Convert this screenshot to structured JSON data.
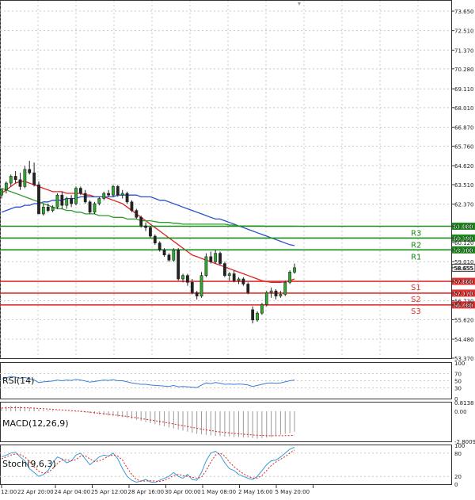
{
  "chart_data": {
    "type": "candlestick",
    "price_axis": {
      "ticks": [
        "73.650",
        "72.510",
        "71.370",
        "70.280",
        "69.110",
        "68.010",
        "66.870",
        "65.760",
        "64.620",
        "63.510",
        "62.370",
        "61.080",
        "60.390",
        "60.120",
        "59.700",
        "59.010",
        "58.655",
        "57.860",
        "57.170",
        "56.730",
        "56.480",
        "55.620",
        "54.480",
        "53.370"
      ],
      "ylim": [
        53.37,
        74.3
      ]
    },
    "time_axis": {
      "labels": [
        "12:00",
        "22 Apr 20:00",
        "24 Apr 04:00",
        "25 Apr 12:00",
        "28 Apr 16:00",
        "30 Apr 00:00",
        "1 May 08:00",
        "2 May 16:00",
        "5 May 20:00"
      ]
    },
    "current_price": "58.655",
    "levels": [
      {
        "name": "R3",
        "price": 61.08,
        "label": "61.080",
        "color": "#1a8a1a"
      },
      {
        "name": "R2",
        "price": 60.39,
        "label": "60.390",
        "color": "#1a8a1a"
      },
      {
        "name": "R1",
        "price": 59.7,
        "label": "59.700",
        "color": "#1a8a1a"
      },
      {
        "name": "S1",
        "price": 57.86,
        "label": "57.860",
        "color": "#e03030"
      },
      {
        "name": "S2",
        "price": 57.17,
        "label": "57.170",
        "color": "#e03030"
      },
      {
        "name": "S3",
        "price": 56.48,
        "label": "56.480",
        "color": "#e03030"
      }
    ],
    "candles": [
      [
        62.9,
        63.3,
        62.7,
        63.2
      ],
      [
        63.2,
        63.7,
        63.0,
        63.6
      ],
      [
        63.6,
        64.1,
        63.4,
        64.0
      ],
      [
        64.0,
        64.3,
        63.6,
        63.8
      ],
      [
        63.8,
        64.2,
        63.2,
        63.4
      ],
      [
        63.4,
        64.6,
        63.3,
        64.4
      ],
      [
        64.4,
        64.9,
        64.1,
        64.2
      ],
      [
        64.2,
        64.8,
        63.4,
        63.5
      ],
      [
        63.5,
        63.7,
        61.8,
        61.8
      ],
      [
        61.8,
        62.4,
        61.7,
        62.2
      ],
      [
        62.2,
        62.4,
        61.9,
        62.0
      ],
      [
        62.0,
        62.3,
        61.9,
        62.2
      ],
      [
        62.2,
        63.0,
        62.1,
        62.9
      ],
      [
        62.9,
        63.1,
        62.1,
        62.3
      ],
      [
        62.3,
        62.8,
        62.1,
        62.7
      ],
      [
        62.7,
        62.9,
        62.2,
        62.4
      ],
      [
        62.4,
        63.4,
        62.3,
        63.3
      ],
      [
        63.3,
        63.4,
        62.9,
        63.0
      ],
      [
        63.0,
        63.2,
        62.4,
        62.5
      ],
      [
        62.5,
        62.6,
        61.8,
        61.9
      ],
      [
        61.9,
        62.5,
        61.8,
        62.4
      ],
      [
        62.4,
        62.8,
        62.3,
        62.7
      ],
      [
        62.7,
        63.1,
        62.6,
        63.0
      ],
      [
        63.0,
        63.2,
        62.8,
        62.9
      ],
      [
        62.9,
        63.5,
        62.8,
        63.4
      ],
      [
        63.4,
        63.5,
        62.8,
        62.9
      ],
      [
        62.9,
        63.2,
        62.7,
        63.0
      ],
      [
        63.0,
        63.1,
        62.4,
        62.5
      ],
      [
        62.5,
        62.6,
        61.9,
        62.0
      ],
      [
        62.0,
        62.1,
        61.5,
        61.6
      ],
      [
        61.6,
        61.7,
        61.0,
        61.1
      ],
      [
        61.1,
        61.3,
        60.8,
        61.0
      ],
      [
        61.0,
        61.1,
        60.4,
        60.5
      ],
      [
        60.5,
        60.6,
        60.0,
        60.1
      ],
      [
        60.1,
        60.2,
        59.6,
        59.7
      ],
      [
        59.7,
        59.8,
        59.3,
        59.4
      ],
      [
        59.4,
        59.5,
        59.0,
        59.1
      ],
      [
        59.1,
        59.8,
        59.0,
        59.7
      ],
      [
        59.7,
        59.8,
        57.9,
        58.0
      ],
      [
        58.0,
        58.3,
        57.8,
        58.2
      ],
      [
        58.2,
        58.3,
        57.6,
        57.8
      ],
      [
        57.8,
        58.0,
        57.1,
        57.2
      ],
      [
        57.2,
        57.3,
        56.8,
        57.0
      ],
      [
        57.0,
        58.4,
        56.9,
        58.2
      ],
      [
        58.2,
        59.5,
        58.1,
        59.3
      ],
      [
        59.3,
        59.6,
        58.9,
        59.0
      ],
      [
        59.0,
        59.7,
        58.9,
        59.5
      ],
      [
        59.5,
        59.6,
        58.8,
        58.9
      ],
      [
        58.9,
        59.0,
        58.1,
        58.2
      ],
      [
        58.2,
        58.4,
        57.9,
        58.3
      ],
      [
        58.3,
        58.5,
        57.8,
        57.9
      ],
      [
        57.9,
        58.1,
        57.7,
        58.0
      ],
      [
        58.0,
        58.1,
        57.6,
        57.7
      ],
      [
        57.7,
        57.8,
        57.1,
        57.2
      ],
      [
        56.2,
        56.4,
        55.4,
        55.6
      ],
      [
        55.6,
        56.1,
        55.5,
        56.0
      ],
      [
        56.0,
        56.6,
        55.9,
        56.5
      ],
      [
        56.5,
        57.3,
        56.4,
        57.2
      ],
      [
        57.2,
        57.5,
        56.9,
        57.3
      ],
      [
        57.3,
        57.4,
        56.8,
        57.0
      ],
      [
        57.0,
        57.3,
        56.9,
        57.1
      ],
      [
        57.1,
        57.9,
        57.0,
        57.8
      ],
      [
        57.8,
        58.5,
        57.7,
        58.4
      ],
      [
        58.4,
        58.9,
        58.3,
        58.655
      ]
    ],
    "ma_series": [
      {
        "color": "#e02020",
        "values": [
          63.0,
          63.2,
          63.4,
          63.6,
          63.7,
          63.7,
          63.6,
          63.5,
          63.4,
          63.3,
          63.2,
          63.1,
          63.1,
          63.1,
          63.0,
          63.0,
          63.0,
          63.0,
          62.9,
          62.9,
          62.8,
          62.8,
          62.8,
          62.7,
          62.6,
          62.5,
          62.4,
          62.2,
          62.0,
          61.8,
          61.6,
          61.4,
          61.2,
          61.0,
          60.8,
          60.6,
          60.4,
          60.2,
          60.0,
          59.8,
          59.6,
          59.4,
          59.3,
          59.2,
          59.1,
          59.0,
          58.9,
          58.8,
          58.7,
          58.6,
          58.5,
          58.4,
          58.3,
          58.2,
          58.1,
          58.0,
          57.9,
          57.85,
          57.8,
          57.8,
          57.8,
          57.85,
          57.9,
          58.0
        ]
      },
      {
        "color": "#2a4fd0",
        "values": [
          61.9,
          62.0,
          62.1,
          62.2,
          62.2,
          62.3,
          62.3,
          62.4,
          62.4,
          62.5,
          62.5,
          62.6,
          62.6,
          62.6,
          62.7,
          62.7,
          62.7,
          62.8,
          62.8,
          62.8,
          62.8,
          62.8,
          62.8,
          62.8,
          62.8,
          62.9,
          62.9,
          62.9,
          62.9,
          62.9,
          62.8,
          62.8,
          62.8,
          62.7,
          62.6,
          62.6,
          62.5,
          62.4,
          62.3,
          62.2,
          62.1,
          62.0,
          61.9,
          61.8,
          61.7,
          61.6,
          61.5,
          61.5,
          61.4,
          61.3,
          61.2,
          61.1,
          61.0,
          60.9,
          60.8,
          60.7,
          60.6,
          60.5,
          60.4,
          60.3,
          60.2,
          60.1,
          60.0,
          59.95
        ]
      },
      {
        "color": "#2e9a2e",
        "values": [
          63.3,
          63.2,
          63.1,
          63.0,
          62.9,
          62.8,
          62.7,
          62.6,
          62.5,
          62.4,
          62.3,
          62.2,
          62.1,
          62.1,
          62.0,
          62.0,
          61.9,
          61.9,
          61.8,
          61.8,
          61.8,
          61.7,
          61.7,
          61.7,
          61.6,
          61.6,
          61.6,
          61.5,
          61.5,
          61.5,
          61.4,
          61.4,
          61.4,
          61.35,
          61.3,
          61.3,
          61.3,
          61.25,
          61.25,
          61.2,
          61.2,
          61.2,
          61.2,
          61.2,
          61.2,
          61.2,
          61.2,
          61.2,
          61.2,
          61.15,
          61.15,
          61.1,
          61.1,
          61.1,
          61.1,
          61.1,
          61.1,
          61.08,
          61.08,
          61.08,
          61.08,
          61.08,
          61.08,
          61.08
        ]
      }
    ],
    "rsi": {
      "label": "RSI(14)",
      "ticks": [
        "100",
        "70",
        "50",
        "30",
        "0"
      ],
      "values": [
        55,
        58,
        62,
        60,
        57,
        59,
        56,
        52,
        45,
        47,
        48,
        49,
        52,
        50,
        52,
        51,
        54,
        52,
        49,
        46,
        48,
        50,
        52,
        51,
        53,
        50,
        50,
        47,
        44,
        42,
        40,
        40,
        38,
        37,
        36,
        35,
        34,
        37,
        33,
        34,
        33,
        32,
        31,
        38,
        44,
        42,
        45,
        43,
        40,
        41,
        40,
        41,
        40,
        38,
        34,
        37,
        40,
        43,
        44,
        43,
        44,
        47,
        50,
        52
      ]
    },
    "macd": {
      "label": "MACD(12,26,9)",
      "ticks": [
        "0.8138",
        "0.00",
        "-2.8009"
      ],
      "histogram": [
        0.4,
        0.45,
        0.5,
        0.5,
        0.45,
        0.4,
        0.35,
        0.3,
        0.2,
        0.15,
        0.1,
        0.08,
        0.05,
        0.02,
        0,
        -0.02,
        -0.05,
        -0.08,
        -0.12,
        -0.18,
        -0.25,
        -0.3,
        -0.35,
        -0.4,
        -0.45,
        -0.5,
        -0.55,
        -0.6,
        -0.7,
        -0.8,
        -0.9,
        -1.0,
        -1.1,
        -1.2,
        -1.3,
        -1.4,
        -1.5,
        -1.6,
        -1.7,
        -1.8,
        -1.9,
        -2.0,
        -2.1,
        -2.15,
        -2.2,
        -2.25,
        -2.3,
        -2.3,
        -2.35,
        -2.35,
        -2.4,
        -2.4,
        -2.45,
        -2.45,
        -2.5,
        -2.55,
        -2.5,
        -2.45,
        -2.4,
        -2.3,
        -2.2,
        -2.1,
        -2.0,
        -1.9
      ],
      "signal": [
        0.3,
        0.32,
        0.33,
        0.34,
        0.34,
        0.33,
        0.32,
        0.3,
        0.27,
        0.24,
        0.21,
        0.18,
        0.15,
        0.12,
        0.09,
        0.06,
        0.03,
        0,
        -0.04,
        -0.08,
        -0.13,
        -0.18,
        -0.23,
        -0.28,
        -0.33,
        -0.38,
        -0.43,
        -0.48,
        -0.54,
        -0.6,
        -0.67,
        -0.74,
        -0.81,
        -0.88,
        -0.95,
        -1.02,
        -1.1,
        -1.18,
        -1.26,
        -1.34,
        -1.42,
        -1.5,
        -1.58,
        -1.66,
        -1.73,
        -1.8,
        -1.86,
        -1.92,
        -1.97,
        -2.02,
        -2.06,
        -2.1,
        -2.14,
        -2.17,
        -2.2,
        -2.23,
        -2.25,
        -2.27,
        -2.28,
        -2.28,
        -2.28,
        -2.27,
        -2.26,
        -2.24
      ]
    },
    "stoch": {
      "label": "Stoch(9,6,3)",
      "ticks": [
        "100",
        "80",
        "20",
        "0"
      ],
      "k": [
        70,
        75,
        80,
        82,
        70,
        60,
        40,
        30,
        20,
        25,
        35,
        55,
        70,
        65,
        55,
        60,
        75,
        80,
        65,
        50,
        60,
        70,
        75,
        72,
        80,
        65,
        40,
        20,
        10,
        5,
        8,
        12,
        6,
        4,
        10,
        15,
        20,
        30,
        20,
        15,
        25,
        12,
        10,
        30,
        60,
        80,
        85,
        75,
        55,
        40,
        35,
        25,
        20,
        15,
        12,
        20,
        35,
        50,
        60,
        62,
        70,
        80,
        90,
        95
      ],
      "d": [
        65,
        70,
        75,
        78,
        76,
        70,
        58,
        45,
        33,
        28,
        30,
        40,
        53,
        62,
        63,
        60,
        63,
        72,
        73,
        65,
        58,
        60,
        65,
        72,
        75,
        72,
        62,
        42,
        25,
        12,
        8,
        8,
        9,
        8,
        7,
        10,
        15,
        22,
        25,
        22,
        20,
        18,
        15,
        18,
        35,
        57,
        75,
        80,
        72,
        57,
        45,
        35,
        27,
        20,
        16,
        16,
        22,
        35,
        48,
        57,
        64,
        71,
        80,
        88
      ]
    }
  }
}
